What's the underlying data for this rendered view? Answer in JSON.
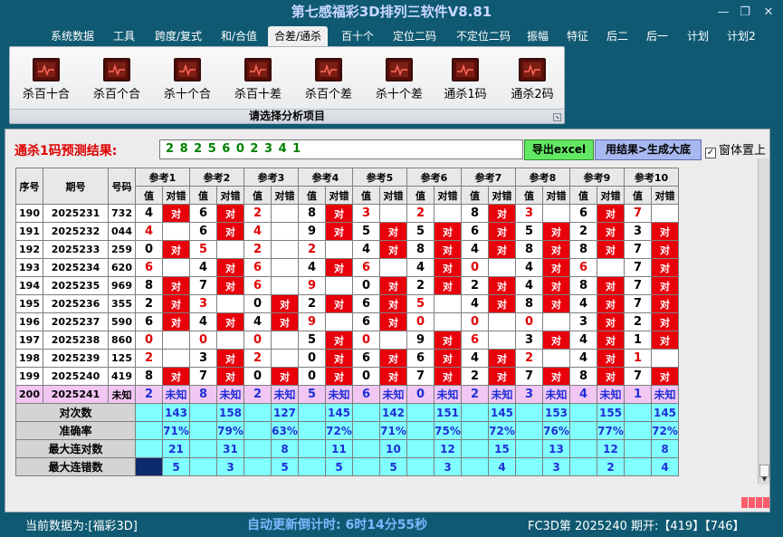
{
  "app": {
    "title": "第七感福彩3D排列三软件V8.81",
    "min_glyph": "—",
    "restore_glyph": "❐",
    "close_glyph": "✕"
  },
  "menu": [
    "系统数据",
    "工具",
    "跨度/复式",
    "和/合值",
    "合差/通杀",
    "百十个",
    "定位二码",
    "不定位二码",
    "振幅",
    "特征",
    "后二",
    "后一",
    "计划",
    "计划2"
  ],
  "menu_active_index": 4,
  "ribbon": {
    "tools": [
      "杀百十合",
      "杀百个合",
      "杀十个合",
      "杀百十差",
      "杀百个差",
      "杀十个差",
      "通杀1码",
      "通杀2码"
    ],
    "caption": "请选择分析项目",
    "launcher_glyph": "↘"
  },
  "prediction": {
    "label": "通杀1码预测结果:",
    "value": "2 8 2 5 6 0 2 3 4 1",
    "export_label": "导出excel",
    "generate_label": "用结果>生成大底",
    "topmost_label": "窗体置上",
    "topmost_checked": "✓"
  },
  "table": {
    "headers": {
      "seq": "序号",
      "period": "期号",
      "code": "号码",
      "value": "值",
      "hit": "对错"
    },
    "groups": [
      "参考1",
      "参考2",
      "参考3",
      "参考4",
      "参考5",
      "参考6",
      "参考7",
      "参考8",
      "参考9",
      "参考10"
    ],
    "rows": [
      {
        "seq": "190",
        "period": "2025231",
        "code": "732",
        "cells": [
          [
            "4",
            "对",
            0
          ],
          [
            "6",
            "对",
            0
          ],
          [
            "2",
            "",
            1
          ],
          [
            "8",
            "对",
            0
          ],
          [
            "3",
            "",
            1
          ],
          [
            "2",
            "",
            1
          ],
          [
            "8",
            "对",
            0
          ],
          [
            "3",
            "",
            1
          ],
          [
            "6",
            "对",
            0
          ],
          [
            "7",
            "",
            1
          ]
        ]
      },
      {
        "seq": "191",
        "period": "2025232",
        "code": "044",
        "cells": [
          [
            "4",
            "",
            1
          ],
          [
            "6",
            "对",
            0
          ],
          [
            "4",
            "",
            1
          ],
          [
            "9",
            "对",
            0
          ],
          [
            "5",
            "对",
            0
          ],
          [
            "5",
            "对",
            0
          ],
          [
            "6",
            "对",
            0
          ],
          [
            "5",
            "对",
            0
          ],
          [
            "2",
            "对",
            0
          ],
          [
            "3",
            "对",
            0
          ]
        ]
      },
      {
        "seq": "192",
        "period": "2025233",
        "code": "259",
        "cells": [
          [
            "0",
            "对",
            0
          ],
          [
            "5",
            "",
            1
          ],
          [
            "2",
            "",
            1
          ],
          [
            "2",
            "",
            1
          ],
          [
            "4",
            "对",
            0
          ],
          [
            "8",
            "对",
            0
          ],
          [
            "4",
            "对",
            0
          ],
          [
            "8",
            "对",
            0
          ],
          [
            "8",
            "对",
            0
          ],
          [
            "7",
            "对",
            0
          ]
        ]
      },
      {
        "seq": "193",
        "period": "2025234",
        "code": "620",
        "cells": [
          [
            "6",
            "",
            1
          ],
          [
            "4",
            "对",
            0
          ],
          [
            "6",
            "",
            1
          ],
          [
            "4",
            "对",
            0
          ],
          [
            "6",
            "",
            1
          ],
          [
            "4",
            "对",
            0
          ],
          [
            "0",
            "",
            1
          ],
          [
            "4",
            "对",
            0
          ],
          [
            "6",
            "",
            1
          ],
          [
            "7",
            "对",
            0
          ]
        ]
      },
      {
        "seq": "194",
        "period": "2025235",
        "code": "969",
        "cells": [
          [
            "8",
            "对",
            0
          ],
          [
            "7",
            "对",
            0
          ],
          [
            "6",
            "",
            1
          ],
          [
            "9",
            "",
            1
          ],
          [
            "0",
            "对",
            0
          ],
          [
            "2",
            "对",
            0
          ],
          [
            "2",
            "对",
            0
          ],
          [
            "4",
            "对",
            0
          ],
          [
            "8",
            "对",
            0
          ],
          [
            "7",
            "对",
            0
          ]
        ]
      },
      {
        "seq": "195",
        "period": "2025236",
        "code": "355",
        "cells": [
          [
            "2",
            "对",
            0
          ],
          [
            "3",
            "",
            1
          ],
          [
            "0",
            "对",
            0
          ],
          [
            "2",
            "对",
            0
          ],
          [
            "6",
            "对",
            0
          ],
          [
            "5",
            "",
            1
          ],
          [
            "4",
            "对",
            0
          ],
          [
            "8",
            "对",
            0
          ],
          [
            "4",
            "对",
            0
          ],
          [
            "7",
            "对",
            0
          ]
        ]
      },
      {
        "seq": "196",
        "period": "2025237",
        "code": "590",
        "cells": [
          [
            "6",
            "对",
            0
          ],
          [
            "4",
            "对",
            0
          ],
          [
            "4",
            "对",
            0
          ],
          [
            "9",
            "",
            1
          ],
          [
            "6",
            "对",
            0
          ],
          [
            "0",
            "",
            1
          ],
          [
            "0",
            "",
            1
          ],
          [
            "0",
            "",
            1
          ],
          [
            "3",
            "对",
            0
          ],
          [
            "2",
            "对",
            0
          ]
        ]
      },
      {
        "seq": "197",
        "period": "2025238",
        "code": "860",
        "cells": [
          [
            "0",
            "",
            1
          ],
          [
            "0",
            "",
            1
          ],
          [
            "0",
            "",
            1
          ],
          [
            "5",
            "对",
            0
          ],
          [
            "0",
            "",
            1
          ],
          [
            "9",
            "对",
            0
          ],
          [
            "6",
            "",
            1
          ],
          [
            "3",
            "对",
            0
          ],
          [
            "4",
            "对",
            0
          ],
          [
            "1",
            "对",
            0
          ]
        ]
      },
      {
        "seq": "198",
        "period": "2025239",
        "code": "125",
        "cells": [
          [
            "2",
            "",
            1
          ],
          [
            "3",
            "对",
            0
          ],
          [
            "2",
            "",
            1
          ],
          [
            "0",
            "对",
            0
          ],
          [
            "6",
            "对",
            0
          ],
          [
            "6",
            "对",
            0
          ],
          [
            "4",
            "对",
            0
          ],
          [
            "2",
            "",
            1
          ],
          [
            "4",
            "对",
            0
          ],
          [
            "1",
            "",
            1
          ]
        ]
      },
      {
        "seq": "199",
        "period": "2025240",
        "code": "419",
        "cells": [
          [
            "8",
            "对",
            0
          ],
          [
            "7",
            "对",
            0
          ],
          [
            "0",
            "对",
            0
          ],
          [
            "0",
            "对",
            0
          ],
          [
            "0",
            "对",
            0
          ],
          [
            "7",
            "对",
            0
          ],
          [
            "2",
            "对",
            0
          ],
          [
            "7",
            "对",
            0
          ],
          [
            "8",
            "对",
            0
          ],
          [
            "7",
            "对",
            0
          ]
        ]
      }
    ],
    "prediction_row": {
      "seq": "200",
      "period": "2025241",
      "code": "未知",
      "values": [
        "2",
        "8",
        "2",
        "5",
        "6",
        "0",
        "2",
        "3",
        "4",
        "1"
      ],
      "status": "未知"
    },
    "stats": [
      {
        "label": "对次数",
        "values": [
          "143",
          "158",
          "127",
          "145",
          "142",
          "151",
          "145",
          "153",
          "155",
          "145"
        ]
      },
      {
        "label": "准确率",
        "values": [
          "71%",
          "79%",
          "63%",
          "72%",
          "71%",
          "75%",
          "72%",
          "76%",
          "77%",
          "72%"
        ]
      },
      {
        "label": "最大连对数",
        "values": [
          "21",
          "31",
          "8",
          "11",
          "10",
          "12",
          "15",
          "13",
          "12",
          "8"
        ]
      },
      {
        "label": "最大连错数",
        "values": [
          "5",
          "3",
          "5",
          "5",
          "5",
          "3",
          "4",
          "3",
          "2",
          "4"
        ]
      }
    ]
  },
  "status": {
    "current_data": "当前数据为:[福彩3D]",
    "countdown": "自动更新倒计时:  6时14分55秒",
    "issue_info": "FC3D第 2025240 期开:【419】【746】"
  },
  "colors": {
    "background": "#0f5a72",
    "hit_red": "#e8000b",
    "stat_cyan": "#80ffff",
    "prediction_pink": "#f2c6f2",
    "export_green": "#63e863",
    "generate_blue": "#a8b8f0",
    "predict_label_red": "#e00000"
  }
}
